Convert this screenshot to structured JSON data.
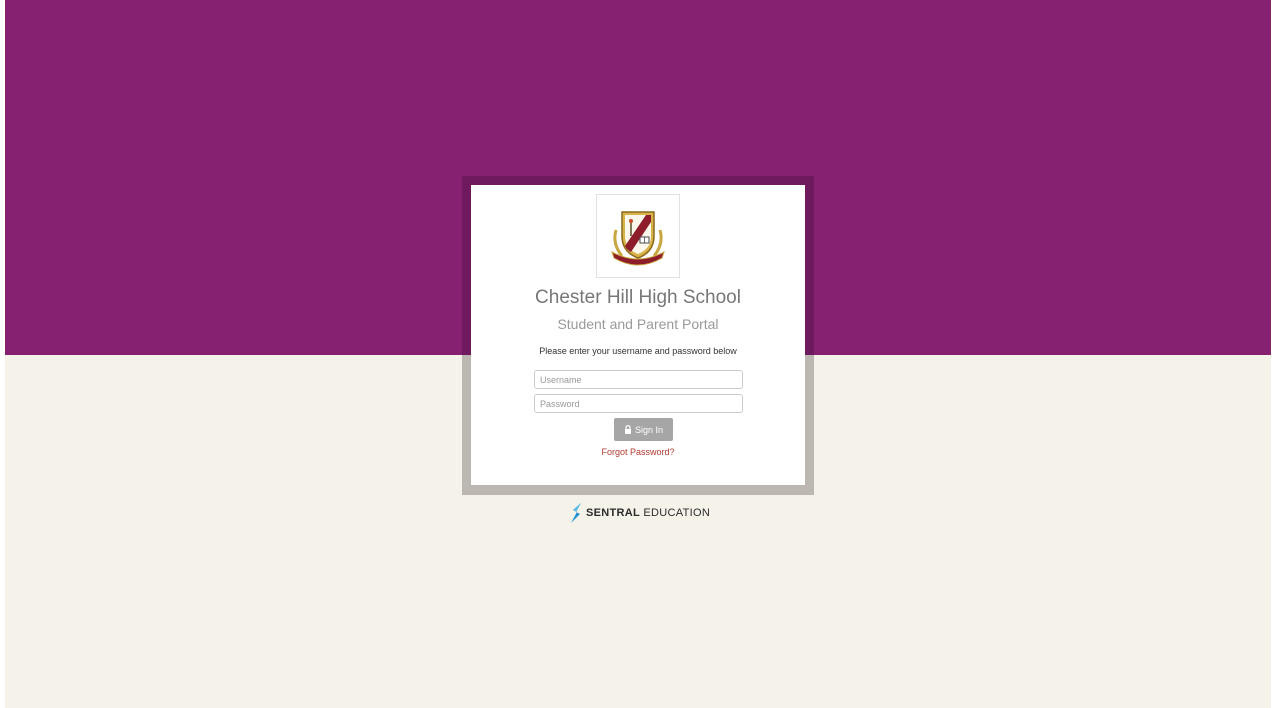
{
  "school": {
    "name": "Chester Hill High School",
    "portal": "Student and Parent Portal",
    "logo_icon": "school-crest-icon"
  },
  "login": {
    "instructions": "Please enter your username and password below",
    "username_placeholder": "Username",
    "password_placeholder": "Password",
    "signin_label": "Sign In",
    "signin_icon": "lock-icon",
    "forgot_label": "Forgot Password?"
  },
  "footer": {
    "brand_bold": "SENTRAL",
    "brand_rest": "EDUCATION",
    "brand_icon": "sentral-logo-icon"
  },
  "colors": {
    "top_band": "#852170",
    "background": "#f5f2ea",
    "button": "#a6a6a6",
    "link": "#b23a2e"
  }
}
